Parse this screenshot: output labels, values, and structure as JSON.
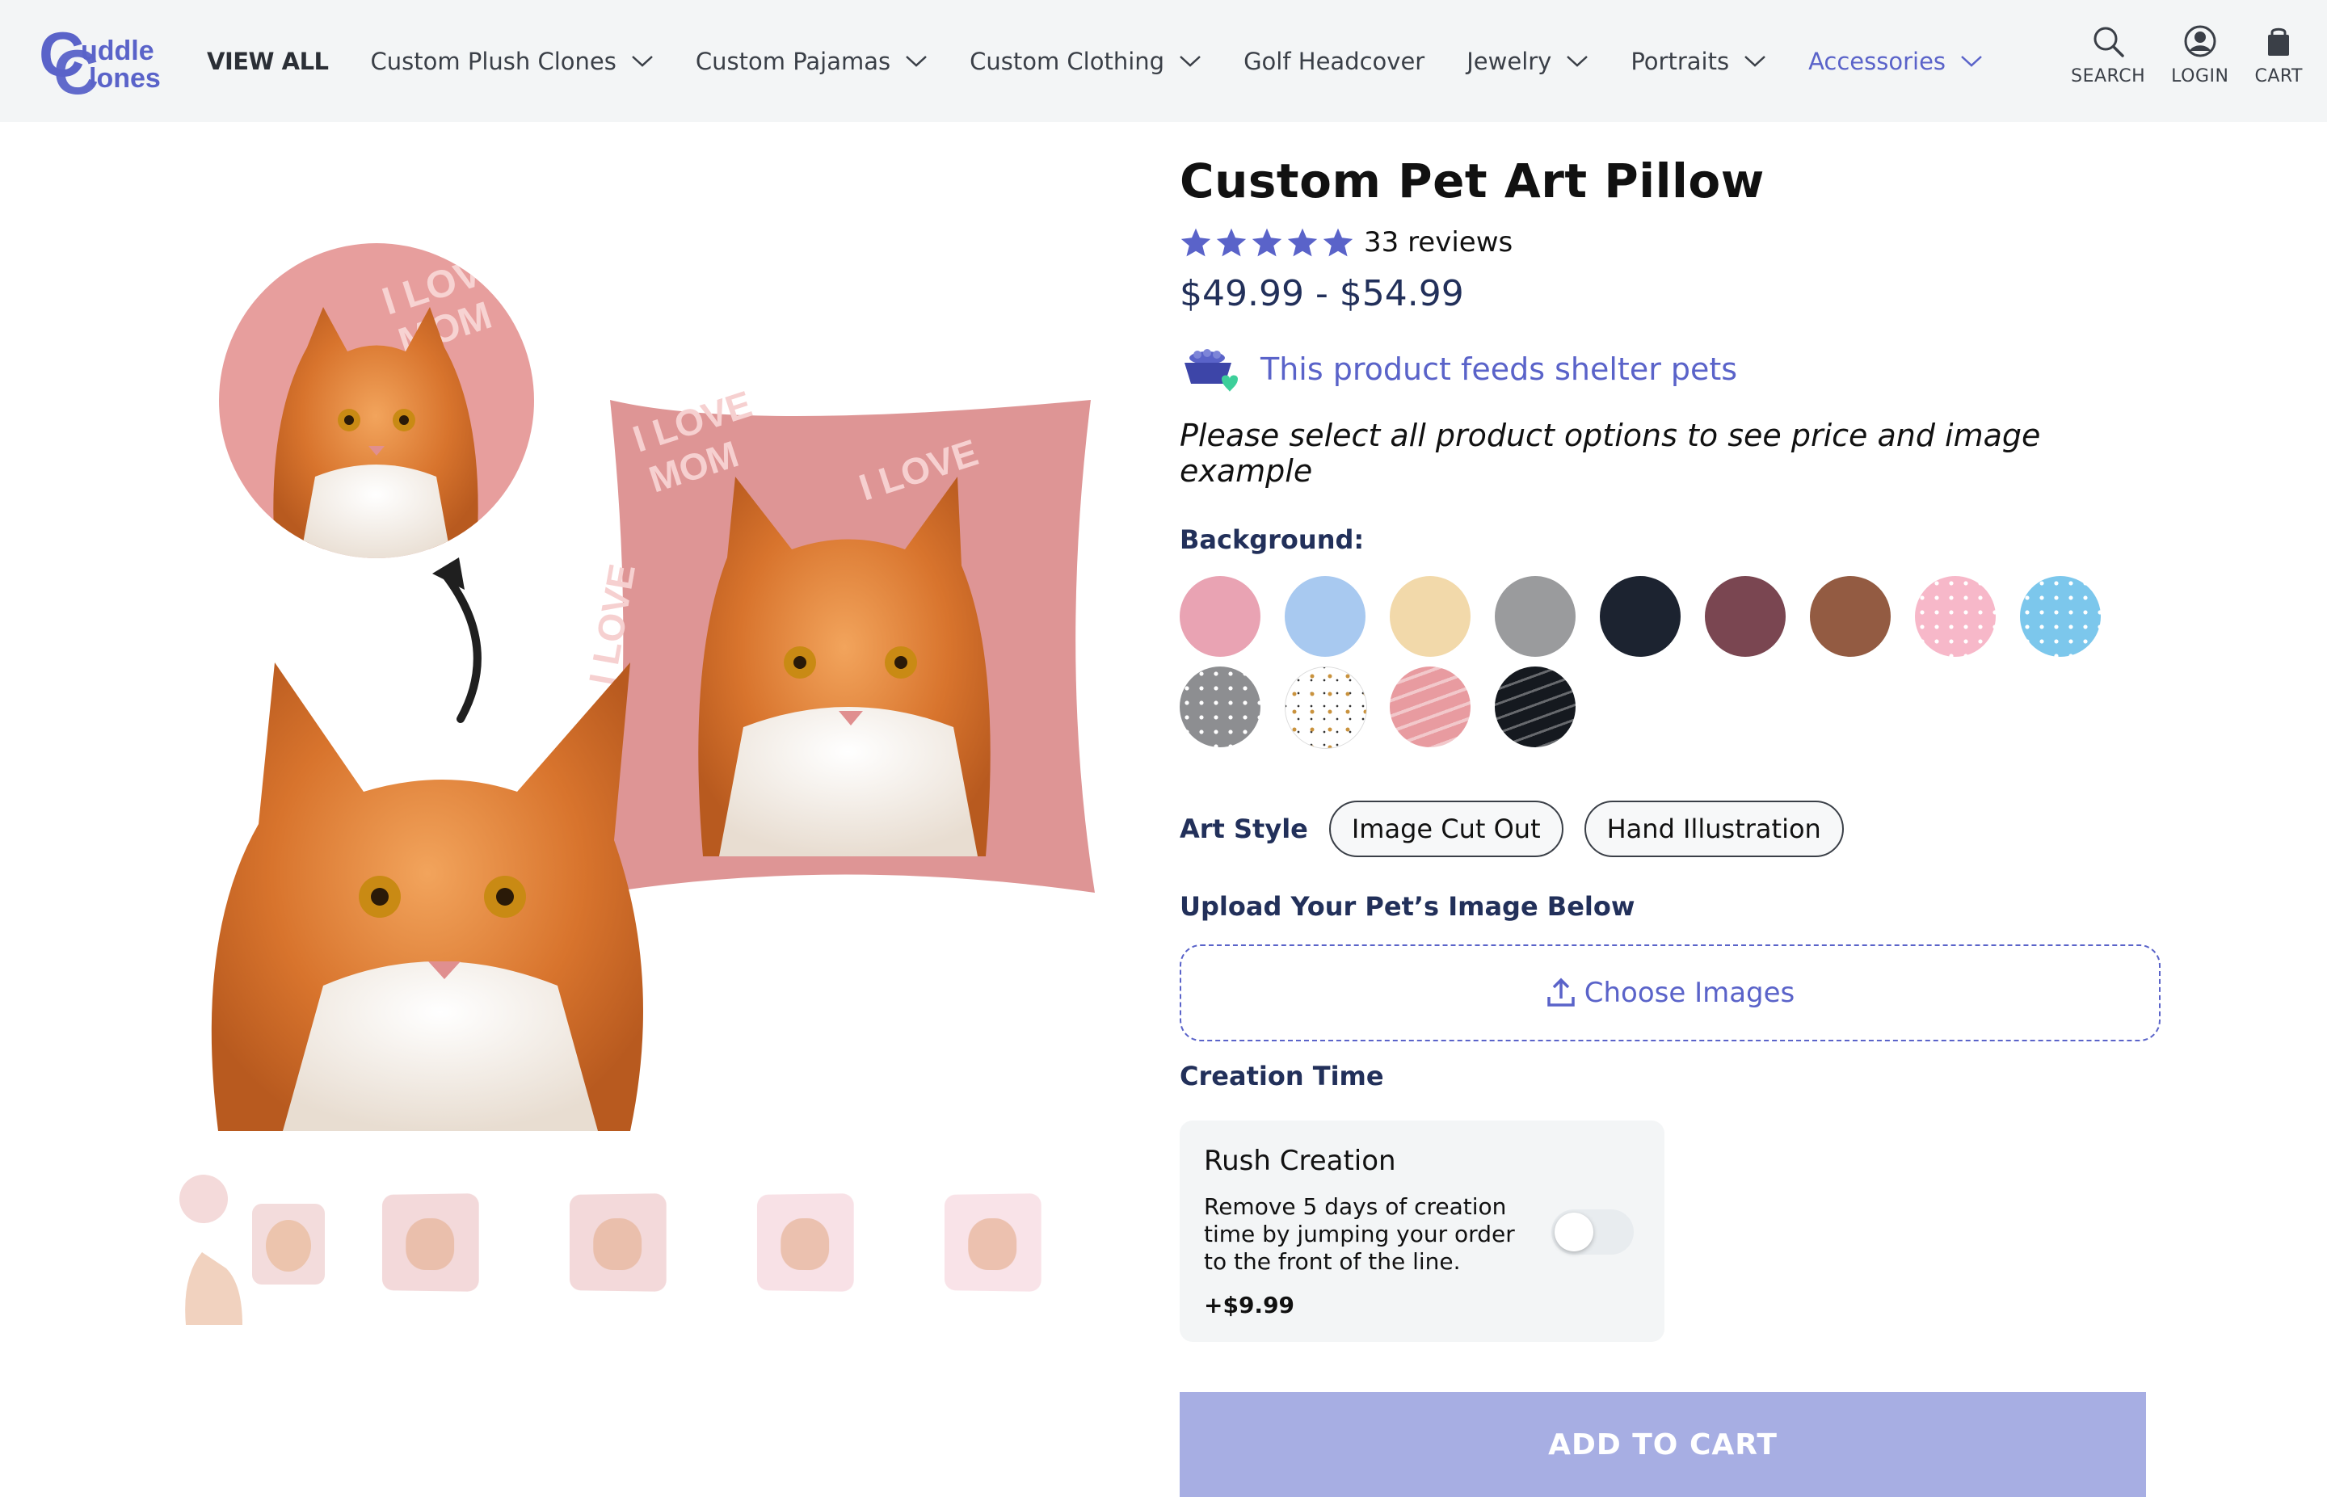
{
  "header": {
    "logo_text_top": "uddle",
    "logo_text_bottom": "lones",
    "nav": [
      {
        "label": "VIEW ALL"
      },
      {
        "label": "Custom Plush Clones"
      },
      {
        "label": "Custom Pajamas"
      },
      {
        "label": "Custom Clothing"
      },
      {
        "label": "Golf Headcover"
      },
      {
        "label": "Jewelry"
      },
      {
        "label": "Portraits"
      },
      {
        "label": "Accessories"
      }
    ],
    "tools": {
      "search": "SEARCH",
      "login": "LOGIN",
      "cart": "CART"
    }
  },
  "gallery": {
    "pillow_text": [
      "I LOVE",
      "MOM"
    ]
  },
  "product": {
    "title": "Custom Pet Art Pillow",
    "rating_stars": 5,
    "reviews": "33 reviews",
    "price": "$49.99 - $54.99",
    "shelter_text": "This product feeds shelter pets",
    "note": "Please select all product options to see price and image example",
    "background_label": "Background:",
    "backgrounds": [
      {
        "name": "pink",
        "color": "#e9a3b3"
      },
      {
        "name": "light-blue",
        "color": "#a8c9f0"
      },
      {
        "name": "cream",
        "color": "#f2d9aa"
      },
      {
        "name": "gray",
        "color": "#9a9b9d"
      },
      {
        "name": "navy",
        "color": "#1c2330"
      },
      {
        "name": "wine",
        "color": "#7a4651"
      },
      {
        "name": "brown",
        "color": "#935b42"
      },
      {
        "name": "pink-dots",
        "color": "#f7b8c9"
      },
      {
        "name": "blue-dots",
        "color": "#7cc7ec"
      },
      {
        "name": "gray-dots",
        "color": "#8d8e91"
      },
      {
        "name": "bones",
        "color": "#ffffff"
      },
      {
        "name": "i-love-mom",
        "color": "#e89ba0"
      },
      {
        "name": "i-love-dad",
        "color": "#15191f"
      }
    ],
    "art_style_label": "Art Style",
    "art_styles": [
      "Image Cut Out",
      "Hand Illustration"
    ],
    "upload_label": "Upload Your Pet’s Image Below",
    "upload_button": "Choose Images",
    "creation_label": "Creation Time",
    "rush": {
      "title": "Rush Creation",
      "description": "Remove 5 days of creation time by jumping your order to the front of the line.",
      "price": "+$9.99",
      "enabled": false
    },
    "add_to_cart": "ADD TO CART"
  },
  "colors": {
    "accent": "#5a63c9",
    "price": "#22305a",
    "cart": "#a7aee3",
    "header_bg": "#f3f5f6"
  },
  "icons": [
    "search-icon",
    "user-icon",
    "bag-icon",
    "chevron-down-icon",
    "star-icon",
    "food-bowl-icon",
    "upload-icon",
    "arrow-icon"
  ]
}
